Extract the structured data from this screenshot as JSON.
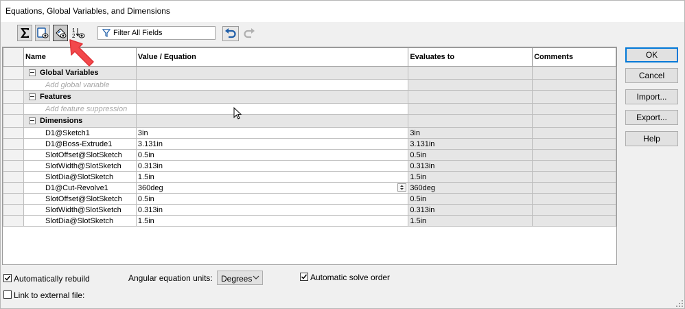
{
  "window": {
    "title": "Equations, Global Variables, and Dimensions"
  },
  "toolbar": {
    "buttons": [
      {
        "icon": "sigma-icon",
        "state": "pressed"
      },
      {
        "icon": "sketch-view-icon",
        "state": "pressed"
      },
      {
        "icon": "ordered-view-icon",
        "state": "active"
      },
      {
        "icon": "sort-order-icon",
        "state": "normal"
      }
    ],
    "filter_placeholder": "Filter All Fields"
  },
  "grid": {
    "columns": {
      "name": "Name",
      "value": "Value / Equation",
      "evaluates": "Evaluates to",
      "comments": "Comments"
    },
    "sections": {
      "global": {
        "label": "Global Variables",
        "add_placeholder": "Add global variable"
      },
      "features": {
        "label": "Features",
        "add_placeholder": "Add feature suppression"
      },
      "dimensions": {
        "label": "Dimensions"
      }
    },
    "rows": [
      {
        "name": "D1@Sketch1",
        "value": "3in",
        "evaluates": "3in"
      },
      {
        "name": "D1@Boss-Extrude1",
        "value": "3.131in",
        "evaluates": "3.131in"
      },
      {
        "name": "SlotOffset@SlotSketch",
        "value": "0.5in",
        "evaluates": "0.5in"
      },
      {
        "name": "SlotWidth@SlotSketch",
        "value": "0.313in",
        "evaluates": "0.313in"
      },
      {
        "name": "SlotDia@SlotSketch",
        "value": "1.5in",
        "evaluates": "1.5in"
      },
      {
        "name": "D1@Cut-Revolve1",
        "value": "360deg",
        "evaluates": "360deg"
      },
      {
        "name": "SlotOffset@SlotSketch",
        "value": "0.5in",
        "evaluates": "0.5in"
      },
      {
        "name": "SlotWidth@SlotSketch",
        "value": "0.313in",
        "evaluates": "0.313in"
      },
      {
        "name": "SlotDia@SlotSketch",
        "value": "1.5in",
        "evaluates": "1.5in"
      }
    ]
  },
  "buttons": {
    "ok": "OK",
    "cancel": "Cancel",
    "import": "Import...",
    "export": "Export...",
    "help": "Help"
  },
  "options": {
    "auto_rebuild": {
      "label": "Automatically rebuild",
      "checked": true
    },
    "link_external": {
      "label": "Link to external file:",
      "checked": false
    },
    "angular_units": {
      "label": "Angular equation units:",
      "value": "Degrees"
    },
    "auto_solve": {
      "label": "Automatic solve order",
      "checked": true
    }
  },
  "colors": {
    "annotation_arrow": "#f2484b",
    "default_button_border": "#0078d7"
  }
}
